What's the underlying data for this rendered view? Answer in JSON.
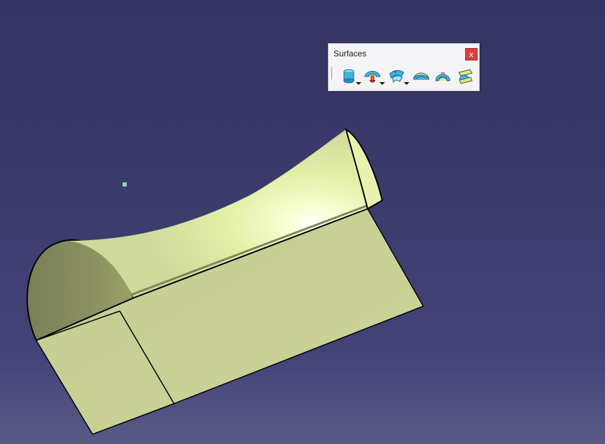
{
  "toolbar": {
    "title": "Surfaces",
    "close_label": "x",
    "tools": [
      {
        "icon": "extrude-surface-icon",
        "has_dropdown": true
      },
      {
        "icon": "revolve-surface-icon",
        "has_dropdown": true
      },
      {
        "icon": "offset-surface-icon",
        "has_dropdown": true
      },
      {
        "icon": "sweep-surface-icon",
        "has_dropdown": false
      },
      {
        "icon": "multi-section-surface-icon",
        "has_dropdown": false
      },
      {
        "icon": "blend-surface-icon",
        "has_dropdown": false
      }
    ]
  },
  "colors": {
    "background_top": "#343463",
    "background_bottom": "#5a5a86",
    "surface_face": "#c8d196",
    "surface_highlight": "#f4ffc8",
    "surface_shadow": "#7a7f58",
    "edge": "#000000"
  }
}
